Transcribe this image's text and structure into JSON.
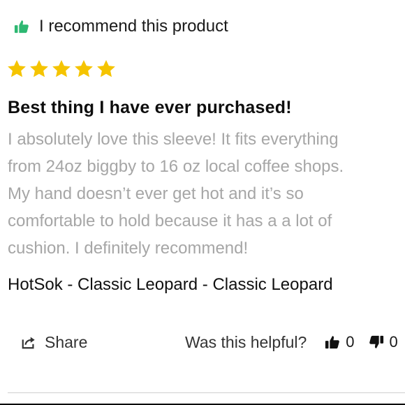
{
  "review": {
    "recommendation": {
      "icon": "thumbs-up-icon",
      "icon_color": "#2eb872",
      "text": "I recommend this product"
    },
    "rating": {
      "stars": 5,
      "max": 5,
      "star_color": "#f5c400",
      "star_icon": "star-icon"
    },
    "title": "Best thing I have ever purchased!",
    "body_lines": [
      "I absolutely love this sleeve! It fits everything",
      "from 24oz biggby to 16 oz local coffee shops.",
      "My hand doesn’t ever get hot and it’s so",
      "comfortable to hold because it has a a lot of",
      "cushion. I definitely recommend!"
    ],
    "body_color": "#a6a6a6",
    "product": "HotSok - Classic Leopard - Classic Leopard"
  },
  "footer": {
    "share": {
      "icon": "share-icon",
      "label": "Share"
    },
    "helpful": {
      "label": "Was this helpful?",
      "up": {
        "icon": "thumbs-up-icon",
        "count": "0"
      },
      "down": {
        "icon": "thumbs-down-icon",
        "count": "0"
      }
    }
  }
}
